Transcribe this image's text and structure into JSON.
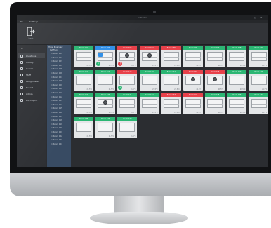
{
  "app": {
    "title": "eRooms",
    "window_controls": [
      "—",
      "□",
      "✕"
    ]
  },
  "menubar": {
    "items": [
      "File",
      "Settings"
    ]
  },
  "toolbar": {
    "logout_label": "Logout"
  },
  "sidebar": {
    "header": "≡",
    "items": [
      {
        "label": "Locations",
        "icon": "building-icon",
        "active": true
      },
      {
        "label": "History",
        "icon": "history-icon"
      },
      {
        "label": "Guests",
        "icon": "guests-icon"
      },
      {
        "label": "Staff",
        "icon": "staff-icon"
      },
      {
        "label": "Assignments",
        "icon": "assignments-icon"
      },
      {
        "label": "Report",
        "icon": "report-icon"
      },
      {
        "label": "Admin",
        "icon": "admin-icon"
      },
      {
        "label": "Log Export",
        "icon": "export-icon"
      }
    ]
  },
  "tree": {
    "header": "Hotel Riverview",
    "sub": "1st Floor",
    "items": [
      "Room 101",
      "Room 102",
      "Room 103",
      "Room 104",
      "Room 105",
      "Room 106",
      "Room 107",
      "Room 108",
      "Room 109",
      "Room 110",
      "Room 111",
      "Room 112",
      "Room 113",
      "Room 114",
      "Room 115",
      "Room 116",
      "Room 117",
      "Room 118",
      "Room 119",
      "Room 120",
      "Room 121",
      "Room 122",
      "Room 123",
      "Room 124"
    ]
  },
  "colors": {
    "free": "#2bb673",
    "occupied": "#e8414a",
    "service": "#2f8fe8",
    "tile_bg": "#e4e6e8"
  },
  "rooms": [
    {
      "label": "Room 101",
      "status": "free",
      "state_icon": "",
      "footer": "21.5°C"
    },
    {
      "label": "Room 102",
      "status": "service",
      "state_icon": "cardkey-check",
      "footer": "21.5°C"
    },
    {
      "label": "Room 103",
      "status": "occupied",
      "state_icon": "sensor-fire",
      "footer": "21.5°C"
    },
    {
      "label": "Room 104",
      "status": "occupied",
      "state_icon": "sensor",
      "footer": "21.5°C"
    },
    {
      "label": "Room 105",
      "status": "occupied",
      "state_icon": "",
      "footer": "21.5°C"
    },
    {
      "label": "Room 106",
      "status": "free",
      "state_icon": "",
      "footer": "21.5°C"
    },
    {
      "label": "Room 107",
      "status": "free",
      "state_icon": "",
      "footer": "21.5°C"
    },
    {
      "label": "Room 108",
      "status": "free",
      "state_icon": "",
      "footer": "21.5°C"
    },
    {
      "label": "Room 109",
      "status": "free",
      "state_icon": "",
      "footer": "21.5°C"
    },
    {
      "label": "Room 110",
      "status": "free",
      "state_icon": "",
      "footer": "21.5°C"
    },
    {
      "label": "Room 111",
      "status": "free",
      "state_icon": "",
      "footer": "21.5°C"
    },
    {
      "label": "Room 112",
      "status": "occupied",
      "state_icon": "check",
      "footer": "21.5°C"
    },
    {
      "label": "Room 113",
      "status": "free",
      "state_icon": "",
      "footer": "21.5°C"
    },
    {
      "label": "Room 114",
      "status": "free",
      "state_icon": "",
      "footer": "21.5°C"
    },
    {
      "label": "Room 115",
      "status": "occupied",
      "state_icon": "sensor",
      "footer": "21.5°C"
    },
    {
      "label": "Room 116",
      "status": "occupied",
      "state_icon": "sensor",
      "footer": "21.5°C"
    },
    {
      "label": "Room 117",
      "status": "free",
      "state_icon": "",
      "footer": "21.5°C"
    },
    {
      "label": "Room 118",
      "status": "free",
      "state_icon": "",
      "footer": "21.5°C"
    },
    {
      "label": "Room 119",
      "status": "free",
      "state_icon": "",
      "footer": "21.5°C"
    },
    {
      "label": "Room 120",
      "status": "free",
      "state_icon": "sensor",
      "footer": "21.5°C"
    },
    {
      "label": "Room 121",
      "status": "free",
      "state_icon": "",
      "footer": "21.5°C"
    },
    {
      "label": "Room 122",
      "status": "free",
      "state_icon": "",
      "footer": "21.5°C"
    },
    {
      "label": "Room 123",
      "status": "occupied",
      "state_icon": "",
      "footer": "21.5°C"
    },
    {
      "label": "Room 124",
      "status": "occupied",
      "state_icon": "",
      "footer": "21.5°C"
    },
    {
      "label": "Room 125",
      "status": "free",
      "state_icon": "",
      "footer": "21.5°C"
    },
    {
      "label": "Room 126",
      "status": "free",
      "state_icon": "",
      "footer": "21.5°C"
    },
    {
      "label": "Room 127",
      "status": "free",
      "state_icon": "",
      "footer": "21.5°C"
    },
    {
      "label": "Room 128",
      "status": "free",
      "state_icon": "",
      "footer": "21.5°C"
    },
    {
      "label": "Room 129",
      "status": "free",
      "state_icon": "",
      "footer": "21.5°C"
    },
    {
      "label": "Room 130",
      "status": "free",
      "state_icon": "",
      "footer": "21.5°C"
    }
  ]
}
